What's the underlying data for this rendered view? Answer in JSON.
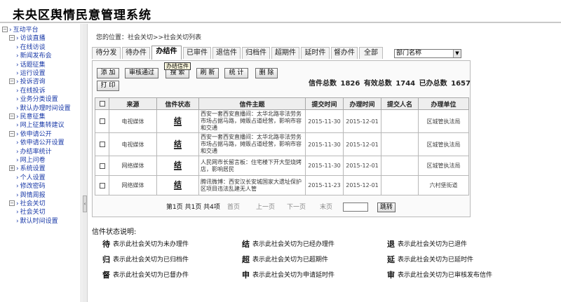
{
  "header": {
    "title": "未央区舆情民意管理系统"
  },
  "sidebar": {
    "items": [
      {
        "label": "互动平台",
        "level": 0,
        "toggle": "minus"
      },
      {
        "label": "访谈直播",
        "level": 1,
        "toggle": "minus"
      },
      {
        "label": "在线访谈",
        "level": 2,
        "toggle": ""
      },
      {
        "label": "新闻发布会",
        "level": 2,
        "toggle": ""
      },
      {
        "label": "话题征集",
        "level": 2,
        "toggle": ""
      },
      {
        "label": "运行设置",
        "level": 2,
        "toggle": ""
      },
      {
        "label": "投诉咨询",
        "level": 1,
        "toggle": "minus"
      },
      {
        "label": "在线投诉",
        "level": 2,
        "toggle": ""
      },
      {
        "label": "业务分类设置",
        "level": 2,
        "toggle": ""
      },
      {
        "label": "默认办理时间设置",
        "level": 2,
        "toggle": ""
      },
      {
        "label": "民意征集",
        "level": 1,
        "toggle": "minus"
      },
      {
        "label": "网上征集转建议",
        "level": 2,
        "toggle": ""
      },
      {
        "label": "依申请公开",
        "level": 1,
        "toggle": "minus"
      },
      {
        "label": "依申请公开设置",
        "level": 2,
        "toggle": ""
      },
      {
        "label": "办结率统计",
        "level": 2,
        "toggle": ""
      },
      {
        "label": "网上问卷",
        "level": 1,
        "toggle": ""
      },
      {
        "label": "系统设置",
        "level": 1,
        "toggle": "plus"
      },
      {
        "label": "个人设置",
        "level": 1,
        "toggle": ""
      },
      {
        "label": "修改密码",
        "level": 1,
        "toggle": ""
      },
      {
        "label": "舆情周报",
        "level": 1,
        "toggle": ""
      },
      {
        "label": "社会关切",
        "level": 1,
        "toggle": "minus"
      },
      {
        "label": "社会关切",
        "level": 2,
        "toggle": ""
      },
      {
        "label": "默认时间设置",
        "level": 2,
        "toggle": ""
      }
    ]
  },
  "breadcrumb": "您的位置：社会关切>>社会关切列表",
  "tabs": [
    "待分发",
    "待办件",
    "办结件",
    "已审件",
    "退信件",
    "归档件",
    "超期件",
    "延时件",
    "督办件",
    "全部"
  ],
  "active_tab": 2,
  "dept_select": {
    "value": "部门名称"
  },
  "toolbar": {
    "add": "添 加",
    "approve": "审核通过",
    "search": "搜 索",
    "refresh": "刷 新",
    "stats": "统 计",
    "delete": "删 除",
    "print": "打 印",
    "tooltip": "办结信件"
  },
  "stats": {
    "total_label": "信件总数",
    "total": "1826",
    "valid_label": "有效总数",
    "valid": "1744",
    "done_label": "已办总数",
    "done": "1657"
  },
  "table": {
    "headers": [
      "来源",
      "信件状态",
      "信件主题",
      "提交时间",
      "办理时间",
      "提交人名",
      "办理单位"
    ],
    "rows": [
      {
        "source": "电视媒体",
        "status_icon": "结",
        "subject": "西安一套西安直播间：太华北路非法劳务市场占据马路，摊贩占道经营，影响市容和交通",
        "submit": "2015-11-30",
        "handle": "2015-12-01",
        "person": "",
        "unit": "区城管执法局"
      },
      {
        "source": "电视媒体",
        "status_icon": "结",
        "subject": "西安一套西安直播间：太华北路非法劳务市场占据马路，摊贩占道经营，影响市容和交通",
        "submit": "2015-11-30",
        "handle": "2015-12-01",
        "person": "",
        "unit": "区城管执法局"
      },
      {
        "source": "网络媒体",
        "status_icon": "结",
        "subject": "人民网市长留言板：住宅楼下开大型烧烤店，影响居民",
        "submit": "2015-11-30",
        "handle": "2015-12-01",
        "person": "",
        "unit": "区城管执法局"
      },
      {
        "source": "网络媒体",
        "status_icon": "结",
        "subject": "腾讯微博：西安汉长安城国家大遗址保护区项目违法乱建无人管",
        "submit": "2015-11-23",
        "handle": "2015-12-01",
        "person": "",
        "unit": "六村堡街道"
      }
    ]
  },
  "pager": {
    "info": "第1页 共1页 共4项",
    "first": "首页",
    "prev": "上一页",
    "next": "下一页",
    "last": "末页",
    "go": "跳转"
  },
  "legend": {
    "title": "信件状态说明:",
    "items": [
      {
        "icon": "待",
        "text": "表示此社会关切为未办理件"
      },
      {
        "icon": "结",
        "text": "表示此社会关切为已经办理件"
      },
      {
        "icon": "退",
        "text": "表示此社会关切为已退件"
      },
      {
        "icon": "归",
        "text": "表示此社会关切为已归档件"
      },
      {
        "icon": "超",
        "text": "表示此社会关切为已超期件"
      },
      {
        "icon": "延",
        "text": "表示此社会关切为已延时件"
      },
      {
        "icon": "督",
        "text": "表示此社会关切为已督办件"
      },
      {
        "icon": "申",
        "text": "表示此社会关切为申请延时件"
      },
      {
        "icon": "审",
        "text": "表示此社会关切为已审核发布信件"
      }
    ]
  }
}
